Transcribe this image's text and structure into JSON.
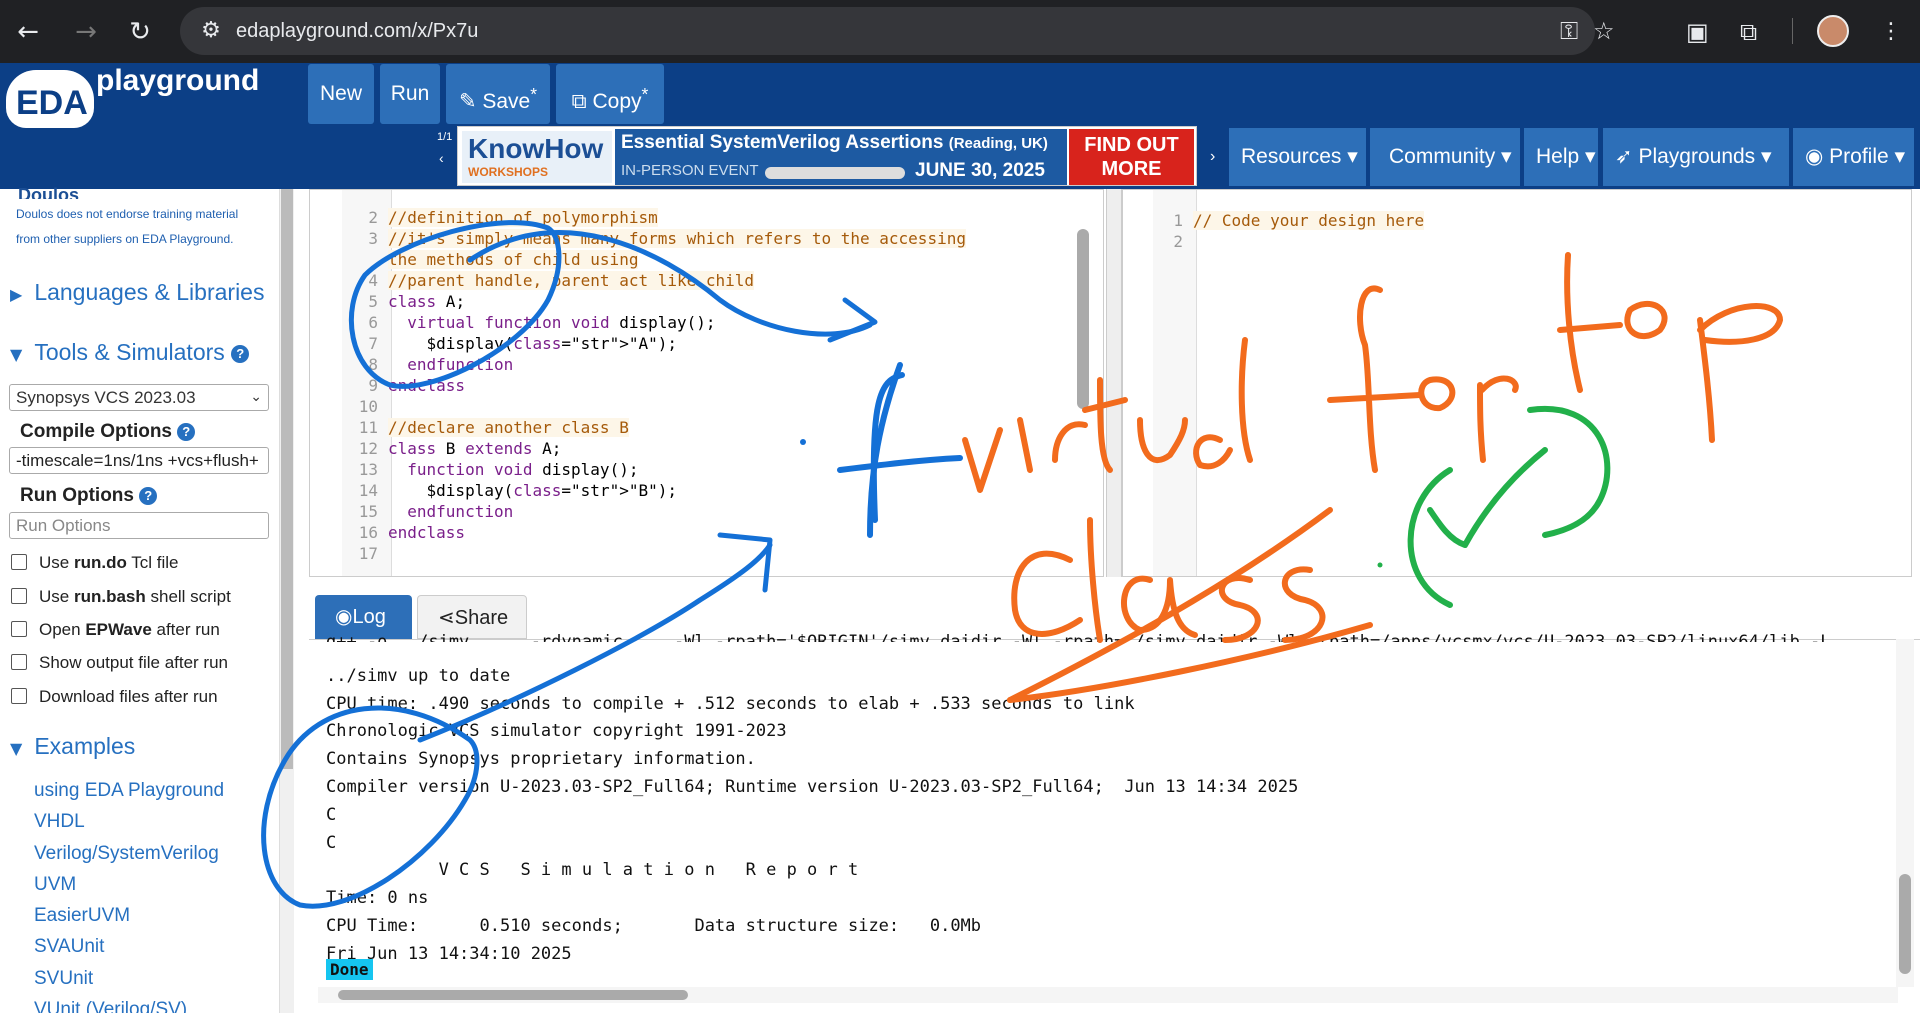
{
  "browser": {
    "url": "edaplayground.com/x/Px7u",
    "back_icon": "arrow-left-icon",
    "forward_icon": "arrow-right-icon",
    "reload_icon": "reload-icon"
  },
  "header": {
    "logo_eda": "EDA",
    "logo_playground": "playground",
    "buttons": {
      "new": "New",
      "run": "Run",
      "save": "Save",
      "copy": "Copy"
    },
    "ad_counter": "1/1",
    "menus": {
      "resources": "Resources",
      "community": "Community",
      "help": "Help",
      "playgrounds": "Playgrounds",
      "profile": "Profile"
    }
  },
  "banner": {
    "brand_top": "KnowHow",
    "brand_bottom": "WORKSHOPS",
    "title": "Essential SystemVerilog Assertions",
    "location": "(Reading, UK)",
    "event": "IN-PERSON EVENT",
    "date": "JUNE 30, 2025",
    "cta_line1": "FIND OUT",
    "cta_line2": "MORE"
  },
  "sidebar": {
    "doulos_text": "Doulos",
    "note1": "Doulos does not endorse training material",
    "note2": "from other suppliers on EDA Playground.",
    "languages": "Languages & Libraries",
    "tools": "Tools & Simulators",
    "simulator": "Synopsys VCS 2023.03",
    "compile_options_label": "Compile Options",
    "compile_options_value": "-timescale=1ns/1ns +vcs+flush+",
    "run_options_label": "Run Options",
    "run_options_placeholder": "Run Options",
    "checkboxes": [
      {
        "pre": "Use ",
        "bold": "run.do",
        "post": " Tcl file"
      },
      {
        "pre": "Use ",
        "bold": "run.bash",
        "post": " shell script"
      },
      {
        "pre": "Open ",
        "bold": "EPWave",
        "post": " after run"
      },
      {
        "pre": "Show output file after run",
        "bold": "",
        "post": ""
      },
      {
        "pre": "Download files after run",
        "bold": "",
        "post": ""
      }
    ],
    "examples_label": "Examples",
    "examples": [
      "using EDA Playground",
      "VHDL",
      "Verilog/SystemVerilog",
      "UVM",
      "EasierUVM",
      "SVAUnit",
      "SVUnit",
      "VUnit (Verilog/SV)"
    ]
  },
  "editor_left": {
    "lines": [
      {
        "n": "2",
        "text": "//definition of polymorphism",
        "kind": "cmt"
      },
      {
        "n": "3",
        "text": "//it's simply means many forms which refers to the accessing",
        "kind": "cmt"
      },
      {
        "n": "",
        "text": "the methods of child using",
        "kind": "cmt"
      },
      {
        "n": "4",
        "text": "//parent handle, parent act like child",
        "kind": "cmt"
      },
      {
        "n": "5",
        "text": "class A;",
        "kind": "code"
      },
      {
        "n": "6",
        "text": "  virtual function void display();",
        "kind": "code"
      },
      {
        "n": "7",
        "text": "    $display(\"A\");",
        "kind": "code"
      },
      {
        "n": "8",
        "text": "  endfunction",
        "kind": "code"
      },
      {
        "n": "9",
        "text": "endclass",
        "kind": "code"
      },
      {
        "n": "10",
        "text": "",
        "kind": "code"
      },
      {
        "n": "11",
        "text": "//declare another class B",
        "kind": "cmt"
      },
      {
        "n": "12",
        "text": "class B extends A;",
        "kind": "code"
      },
      {
        "n": "13",
        "text": "  function void display();",
        "kind": "code"
      },
      {
        "n": "14",
        "text": "    $display(\"B\");",
        "kind": "code"
      },
      {
        "n": "15",
        "text": "  endfunction",
        "kind": "code"
      },
      {
        "n": "16",
        "text": "endclass",
        "kind": "code"
      },
      {
        "n": "17",
        "text": "",
        "kind": "code"
      }
    ]
  },
  "editor_right": {
    "lines": [
      {
        "n": "1",
        "text": "// Code your design here",
        "kind": "cmt"
      },
      {
        "n": "2",
        "text": "",
        "kind": "code"
      }
    ]
  },
  "tabs": {
    "log": "Log",
    "share": "Share"
  },
  "log": {
    "lines": [
      "g++ -o ../simv      -rdynamic     -Wl,-rpath='$ORIGIN'/simv.daidir -Wl,-rpath=./simv.daidir -Wl,-rpath=/apps/vcsmx/vcs/U-2023.03-SP2/linux64/lib -L",
      "../simv up to date",
      "CPU time: .490 seconds to compile + .512 seconds to elab + .533 seconds to link",
      "Chronologic VCS simulator copyright 1991-2023",
      "Contains Synopsys proprietary information.",
      "Compiler version U-2023.03-SP2_Full64; Runtime version U-2023.03-SP2_Full64;  Jun 13 14:34 2025",
      "C",
      "C",
      "           V C S   S i m u l a t i o n   R e p o r t",
      "Time: 0 ns",
      "CPU Time:      0.510 seconds;       Data structure size:   0.0Mb",
      "Fri Jun 13 14:34:10 2025"
    ],
    "done": "Done"
  },
  "annotations": {
    "blue_if": "if",
    "orange_line1": "virtual for top",
    "orange_line2": "class",
    "colors": {
      "blue": "#1470d6",
      "orange": "#f26b1d",
      "green": "#22b04a"
    }
  }
}
